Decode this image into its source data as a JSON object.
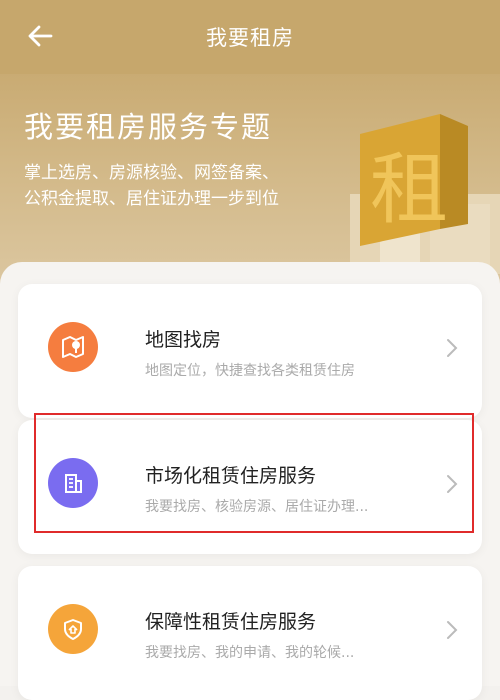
{
  "header": {
    "title": "我要租房",
    "back_icon": "back-arrow-icon"
  },
  "hero": {
    "title": "我要租房服务专题",
    "subtitle_line1": "掌上选房、房源核验、网签备案、",
    "subtitle_line2": "公积金提取、居住证办理一步到位",
    "art_char": "租"
  },
  "services": [
    {
      "title": "地图找房",
      "subtitle": "地图定位，快捷查找各类租赁住房",
      "icon": "map-location-icon",
      "icon_color": "#f57d3f"
    },
    {
      "title": "市场化租赁住房服务",
      "subtitle": "我要找房、核验房源、居住证办理...",
      "icon": "building-icon",
      "icon_color": "#7a6cf0"
    },
    {
      "title": "保障性租赁住房服务",
      "subtitle": "我要找房、我的申请、我的轮候...",
      "icon": "shield-home-icon",
      "icon_color": "#f5a53a"
    }
  ],
  "colors": {
    "header_bg": "#c6a76c",
    "highlight": "#e02b2b"
  }
}
